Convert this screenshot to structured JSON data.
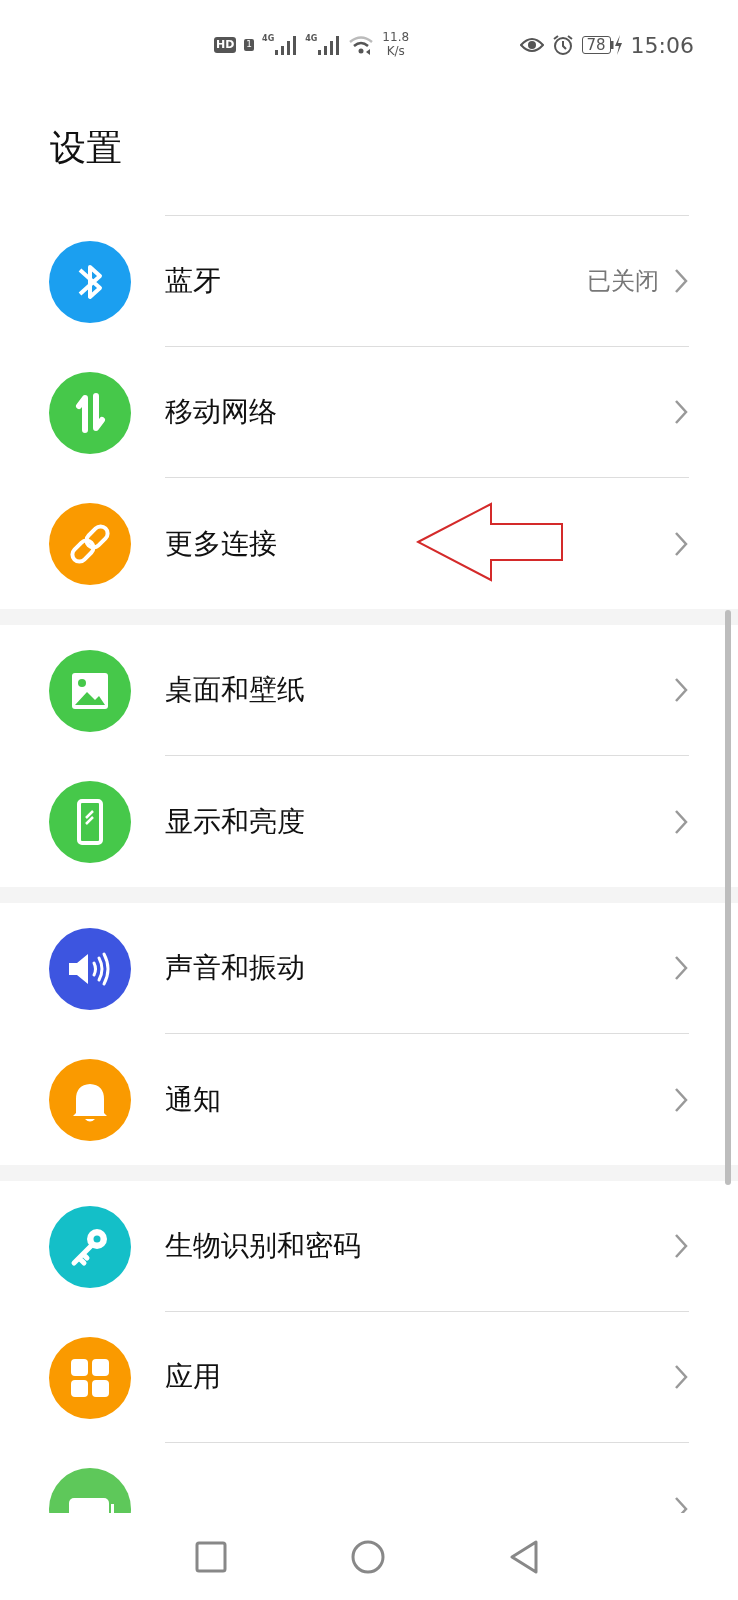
{
  "status_bar": {
    "hd": "HD",
    "sim": "1",
    "signals": [
      {
        "label": "4G"
      },
      {
        "label": "4G"
      }
    ],
    "speed": [
      "11.8",
      "K/s"
    ],
    "battery": "78",
    "time": "15:06"
  },
  "title": "设置",
  "groups": [
    {
      "items": [
        {
          "kind": "bluetooth",
          "color": "#1b9ff0",
          "label": "蓝牙",
          "value": "已关闭",
          "highlighted": false
        },
        {
          "kind": "data",
          "color": "#46c84a",
          "label": "移动网络",
          "highlighted": false
        },
        {
          "kind": "link",
          "color": "#fa9a00",
          "label": "更多连接",
          "highlighted": true
        }
      ]
    },
    {
      "items": [
        {
          "kind": "wallpaper",
          "color": "#46c84a",
          "label": "桌面和壁纸",
          "highlighted": false
        },
        {
          "kind": "display",
          "color": "#46c84a",
          "label": "显示和亮度",
          "highlighted": false
        }
      ]
    },
    {
      "items": [
        {
          "kind": "sound",
          "color": "#3d55e0",
          "label": "声音和振动",
          "highlighted": false
        },
        {
          "kind": "bell",
          "color": "#fa9a00",
          "label": "通知",
          "highlighted": false
        }
      ]
    },
    {
      "items": [
        {
          "kind": "key",
          "color": "#14bfc8",
          "label": "生物识别和密码",
          "highlighted": false
        },
        {
          "kind": "apps",
          "color": "#fa9a00",
          "label": "应用",
          "highlighted": false
        },
        {
          "kind": "battery",
          "color": "#5ec85a",
          "highlighted": false
        }
      ]
    }
  ]
}
